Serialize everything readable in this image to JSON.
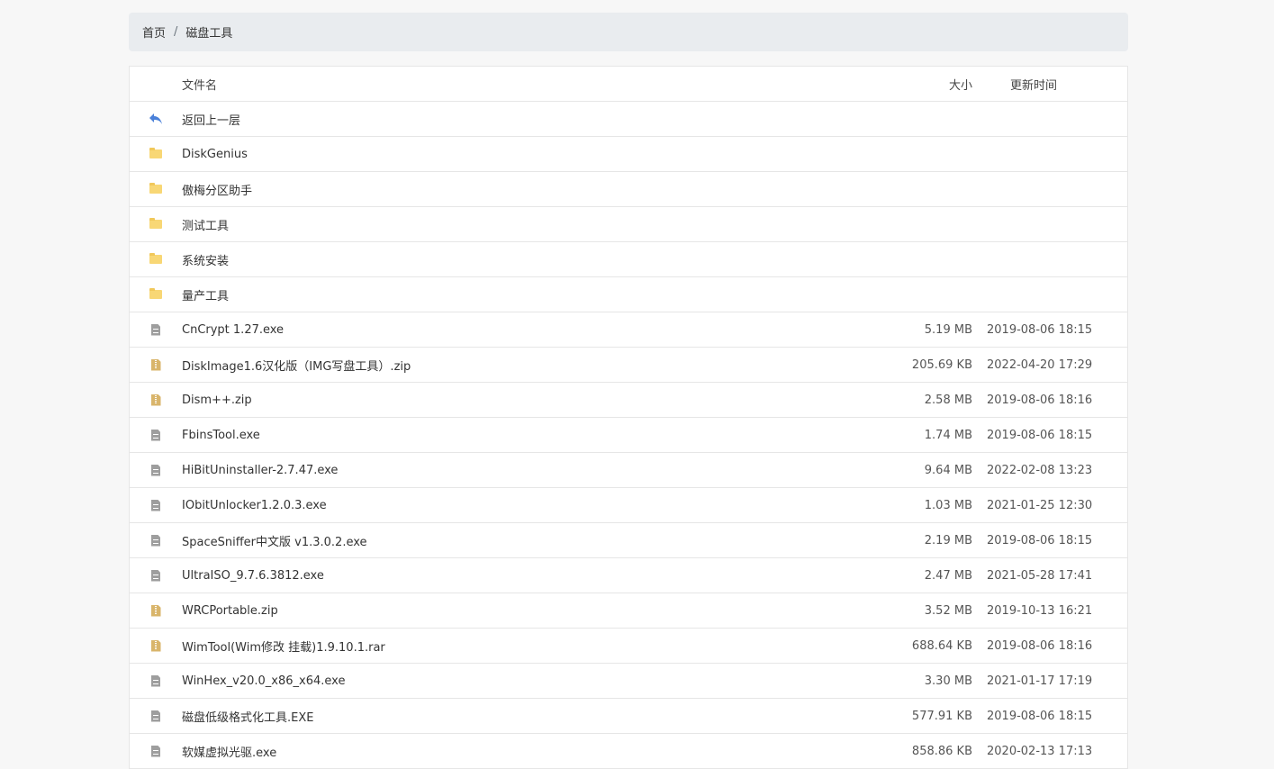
{
  "breadcrumb": {
    "home": "首页",
    "separator": "/",
    "current": "磁盘工具"
  },
  "table": {
    "header": {
      "name": "文件名",
      "size": "大小",
      "time": "更新时间"
    },
    "back": {
      "label": "返回上一层",
      "icon": "back-arrow-icon",
      "icon_color": "#4a80d9"
    },
    "folders": [
      {
        "name": "DiskGenius"
      },
      {
        "name": "傲梅分区助手"
      },
      {
        "name": "测试工具"
      },
      {
        "name": "系统安装"
      },
      {
        "name": "量产工具"
      }
    ],
    "files": [
      {
        "name": "CnCrypt 1.27.exe",
        "size": "5.19 MB",
        "time": "2019-08-06 18:15",
        "type": "file"
      },
      {
        "name": "DiskImage1.6汉化版（IMG写盘工具）.zip",
        "size": "205.69 KB",
        "time": "2022-04-20 17:29",
        "type": "zip"
      },
      {
        "name": "Dism++.zip",
        "size": "2.58 MB",
        "time": "2019-08-06 18:16",
        "type": "zip"
      },
      {
        "name": "FbinsTool.exe",
        "size": "1.74 MB",
        "time": "2019-08-06 18:15",
        "type": "file"
      },
      {
        "name": "HiBitUninstaller-2.7.47.exe",
        "size": "9.64 MB",
        "time": "2022-02-08 13:23",
        "type": "file"
      },
      {
        "name": "IObitUnlocker1.2.0.3.exe",
        "size": "1.03 MB",
        "time": "2021-01-25 12:30",
        "type": "file"
      },
      {
        "name": "SpaceSniffer中文版 v1.3.0.2.exe",
        "size": "2.19 MB",
        "time": "2019-08-06 18:15",
        "type": "file"
      },
      {
        "name": "UltraISO_9.7.6.3812.exe",
        "size": "2.47 MB",
        "time": "2021-05-28 17:41",
        "type": "file"
      },
      {
        "name": "WRCPortable.zip",
        "size": "3.52 MB",
        "time": "2019-10-13 16:21",
        "type": "zip"
      },
      {
        "name": "WimTool(Wim修改 挂载)1.9.10.1.rar",
        "size": "688.64 KB",
        "time": "2019-08-06 18:16",
        "type": "zip"
      },
      {
        "name": "WinHex_v20.0_x86_x64.exe",
        "size": "3.30 MB",
        "time": "2021-01-17 17:19",
        "type": "file"
      },
      {
        "name": "磁盘低级格式化工具.EXE",
        "size": "577.91 KB",
        "time": "2019-08-06 18:15",
        "type": "file"
      },
      {
        "name": "软媒虚拟光驱.exe",
        "size": "858.86 KB",
        "time": "2020-02-13 17:13",
        "type": "file"
      }
    ]
  },
  "colors": {
    "breadcrumb_bg": "#e9ecef",
    "folder": "#f8d775",
    "file": "#9e9e9e",
    "zip": "#d9b56b",
    "back_arrow": "#4a80d9"
  }
}
